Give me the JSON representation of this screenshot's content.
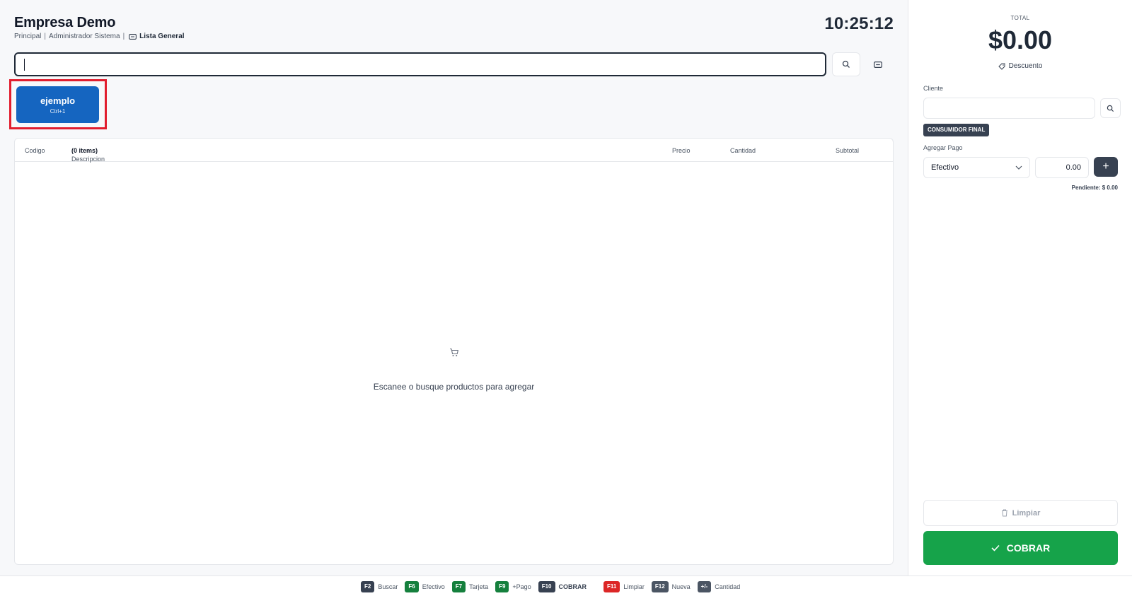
{
  "header": {
    "company": "Empresa Demo",
    "branch": "Principal",
    "user": "Administrador Sistema",
    "price_list": "Lista General",
    "clock": "10:25:12"
  },
  "search": {
    "value": "",
    "placeholder": ""
  },
  "quick_buttons": [
    {
      "label": "ejemplo",
      "shortcut": "Ctrl+1"
    }
  ],
  "table": {
    "columns": {
      "code": "Codigo",
      "description": "Descripcion",
      "items_count": "(0 items)",
      "price": "Precio",
      "quantity": "Cantidad",
      "subtotal": "Subtotal"
    },
    "empty_message": "Escanee o busque productos para agregar"
  },
  "sidebar": {
    "total_label": "TOTAL",
    "total_value": "$0.00",
    "discount_label": "Descuento",
    "client_label": "Cliente",
    "client_value": "",
    "client_badge": "CONSUMIDOR FINAL",
    "add_payment_label": "Agregar Pago",
    "payment_method": "Efectivo",
    "payment_amount": "0.00",
    "add_payment_button": "+",
    "pending": "Pendiente: $ 0.00",
    "clear_label": "Limpiar",
    "charge_label": "COBRAR"
  },
  "footer": {
    "shortcuts": [
      {
        "key": "F2",
        "label": "Buscar",
        "color": "#374151"
      },
      {
        "key": "F6",
        "label": "Efectivo",
        "color": "#15803d"
      },
      {
        "key": "F7",
        "label": "Tarjeta",
        "color": "#15803d"
      },
      {
        "key": "F9",
        "label": "+Pago",
        "color": "#15803d"
      },
      {
        "key": "F10",
        "label": "COBRAR",
        "color": "#374151"
      },
      {
        "key": "F11",
        "label": "Limpiar",
        "color": "#dc2626"
      },
      {
        "key": "F12",
        "label": "Nueva",
        "color": "#4b5563"
      },
      {
        "key": "+/-",
        "label": "Cantidad",
        "color": "#4b5563"
      }
    ]
  },
  "colors": {
    "primary_blue": "#1565c0",
    "success_green": "#16a34a",
    "dark": "#374151",
    "highlight_red": "#e11d2e"
  },
  "icons": [
    "search-icon",
    "barcode-icon",
    "tag-icon",
    "cart-icon",
    "chevron-down-icon",
    "trash-icon",
    "check-icon",
    "plus-icon"
  ]
}
